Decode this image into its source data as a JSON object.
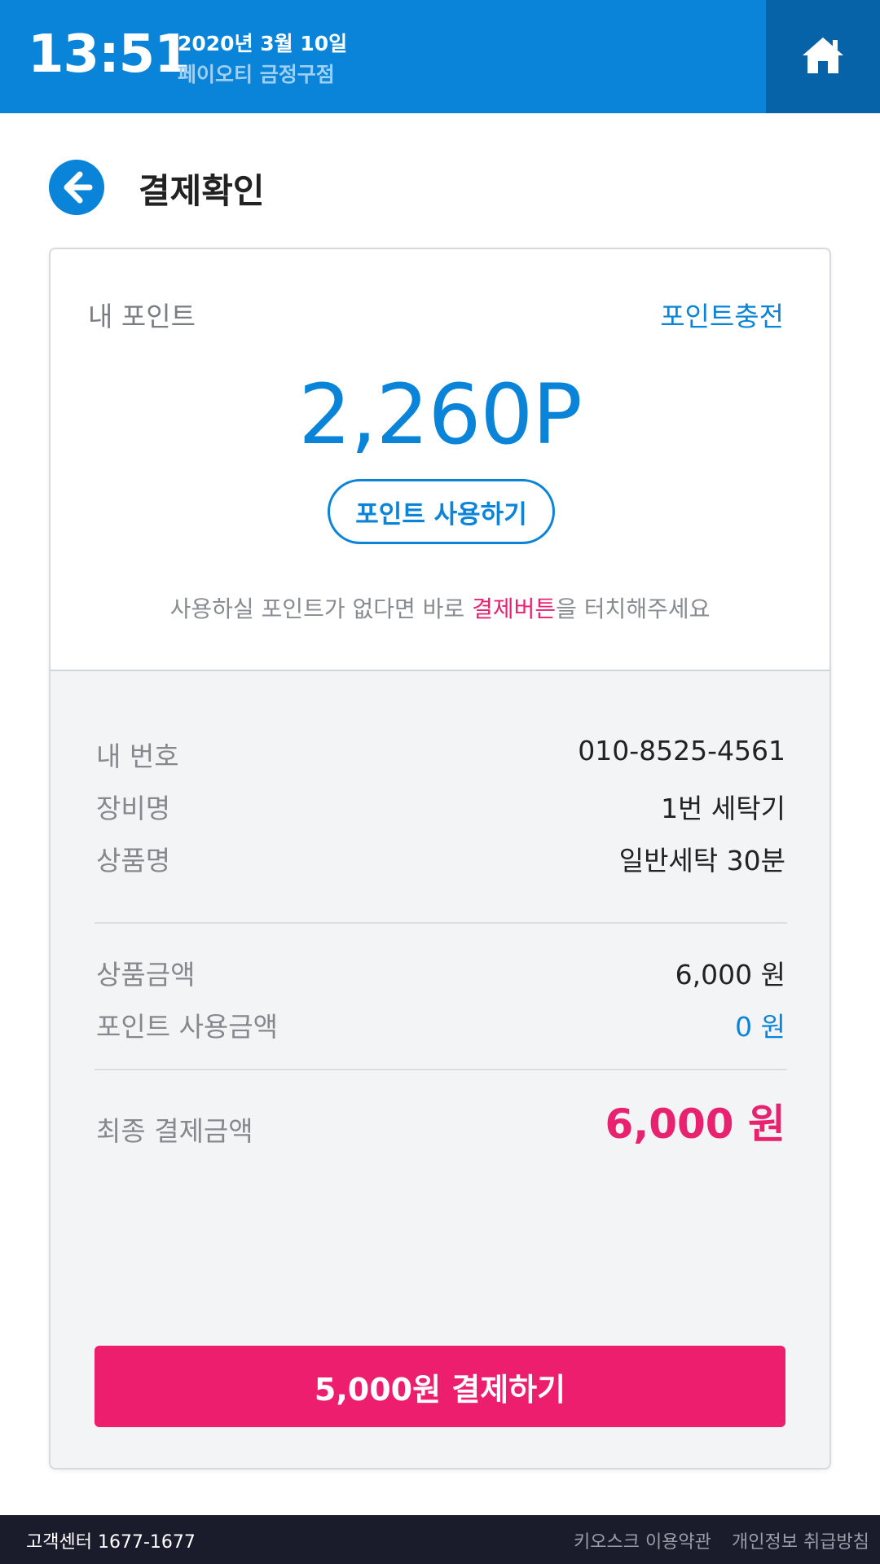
{
  "header": {
    "time": "13:51",
    "date": "2020년 3월 10일",
    "store_name": "페이오티 금정구점",
    "home_icon": "home-icon"
  },
  "page": {
    "back_icon": "arrow-left-icon",
    "title": "결제확인"
  },
  "points": {
    "label": "내 포인트",
    "charge_link": "포인트충전",
    "value": "2,260P",
    "use_button": "포인트 사용하기",
    "hint_before": "사용하실 포인트가 없다면 바로 ",
    "hint_emphasis": "결제버튼",
    "hint_after": "을 터치해주세요"
  },
  "details": {
    "phone_label": "내 번호",
    "phone_value": "010-8525-4561",
    "device_label": "장비명",
    "device_value": "1번 세탁기",
    "product_label": "상품명",
    "product_value": "일반세탁 30분"
  },
  "amounts": {
    "product_amount_label": "상품금액",
    "product_amount_value": "6,000 원",
    "point_use_label": "포인트 사용금액",
    "point_use_value": "0 원",
    "final_label": "최종 결제금액",
    "final_value": "6,000 원"
  },
  "pay_button": "5,000원 결제하기",
  "footer": {
    "customer_center": "고객센터 1677-1677",
    "terms": "키오스크 이용약관",
    "privacy": "개인정보 취급방침"
  },
  "colors": {
    "primary_blue": "#0a84d8",
    "dark_blue": "#0763a8",
    "accent_pink": "#ee1e6f",
    "footer_bg": "#1b1c2b"
  }
}
